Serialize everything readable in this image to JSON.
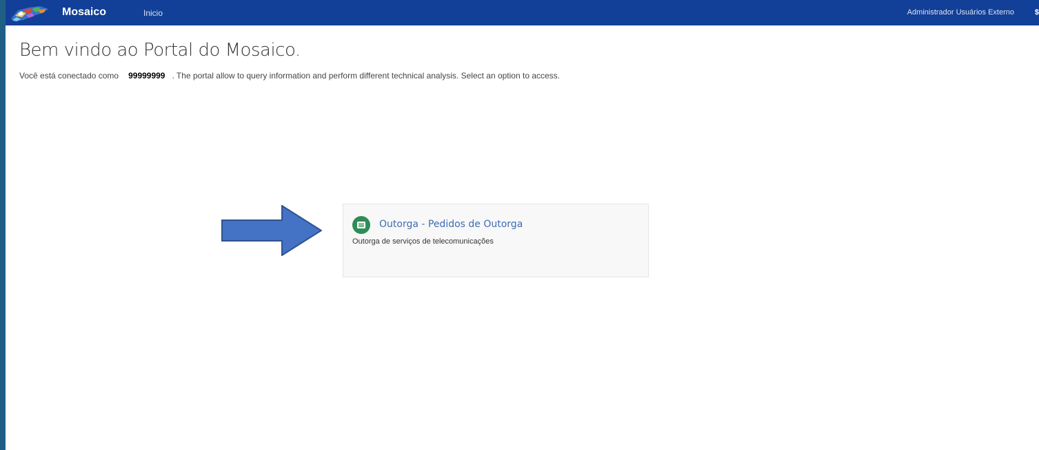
{
  "app": {
    "brand": "Mosaico"
  },
  "navbar": {
    "home_label": "Inicio",
    "user_label": "Administrador Usuários Externo"
  },
  "main": {
    "title": "Bem vindo ao Portal do Mosaico.",
    "intro_prefix": "Você está conectado como",
    "user_id": "99999999",
    "intro_suffix": ". The portal allow to query information and perform different technical analysis. Select an option to access."
  },
  "cards": [
    {
      "title": "Outorga - Pedidos de Outorga",
      "description": "Outorga de serviços de telecomunicações",
      "icon": "list-icon"
    }
  ],
  "colors": {
    "navbar": "#123f97",
    "card_icon": "#2e8c55",
    "card_title": "#3d6cb5",
    "arrow_fill": "#4472c4",
    "arrow_stroke": "#2f5290",
    "outer_background": "#1f5f86"
  }
}
